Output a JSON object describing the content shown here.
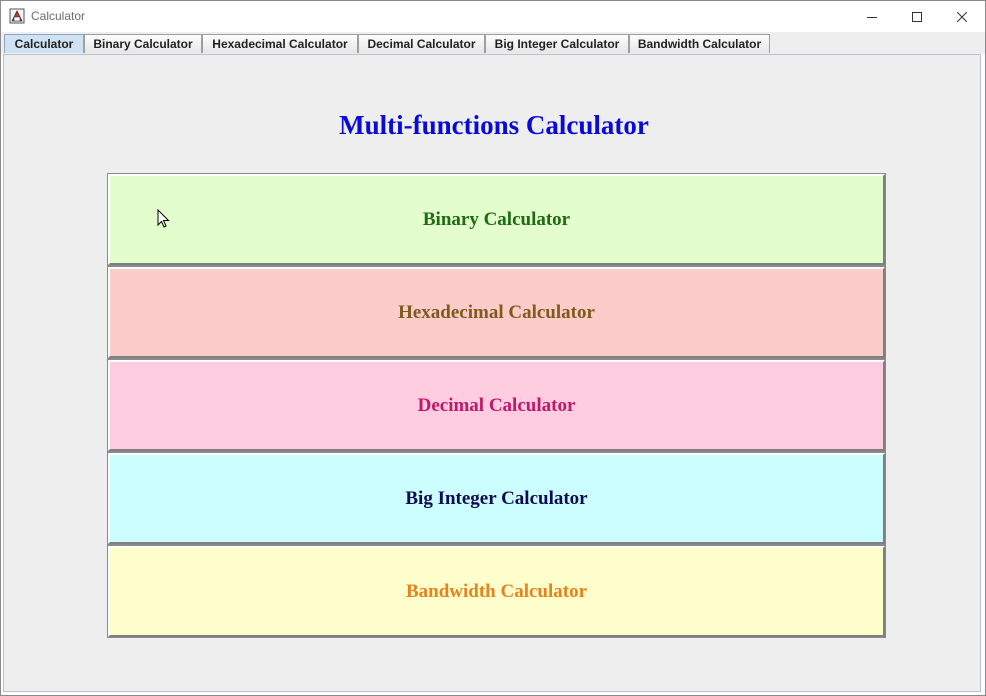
{
  "window": {
    "title": "Calculator"
  },
  "tabs": [
    {
      "label": "Calculator",
      "active": true
    },
    {
      "label": "Binary Calculator",
      "active": false
    },
    {
      "label": "Hexadecimal Calculator",
      "active": false
    },
    {
      "label": "Decimal Calculator",
      "active": false
    },
    {
      "label": "Big Integer Calculator",
      "active": false
    },
    {
      "label": "Bandwidth Calculator",
      "active": false
    }
  ],
  "main": {
    "heading": "Multi-functions Calculator",
    "buttons": [
      {
        "label": "Binary Calculator",
        "bg": "#e3fdcd",
        "fg": "#1e6b12"
      },
      {
        "label": "Hexadecimal Calculator",
        "bg": "#fccccb",
        "fg": "#7e5a1c"
      },
      {
        "label": "Decimal Calculator",
        "bg": "#ffcce0",
        "fg": "#c0186a"
      },
      {
        "label": "Big Integer Calculator",
        "bg": "#ccfeff",
        "fg": "#0c0c52"
      },
      {
        "label": "Bandwidth Calculator",
        "bg": "#fefecc",
        "fg": "#e8821b"
      }
    ]
  },
  "colors": {
    "heading": "#0a0ad8",
    "active_tab": "#cfe1f3",
    "panel_bg": "#eeeeee"
  },
  "icons": [
    "app-icon",
    "minimize-icon",
    "maximize-icon",
    "close-icon",
    "mouse-cursor-icon"
  ]
}
